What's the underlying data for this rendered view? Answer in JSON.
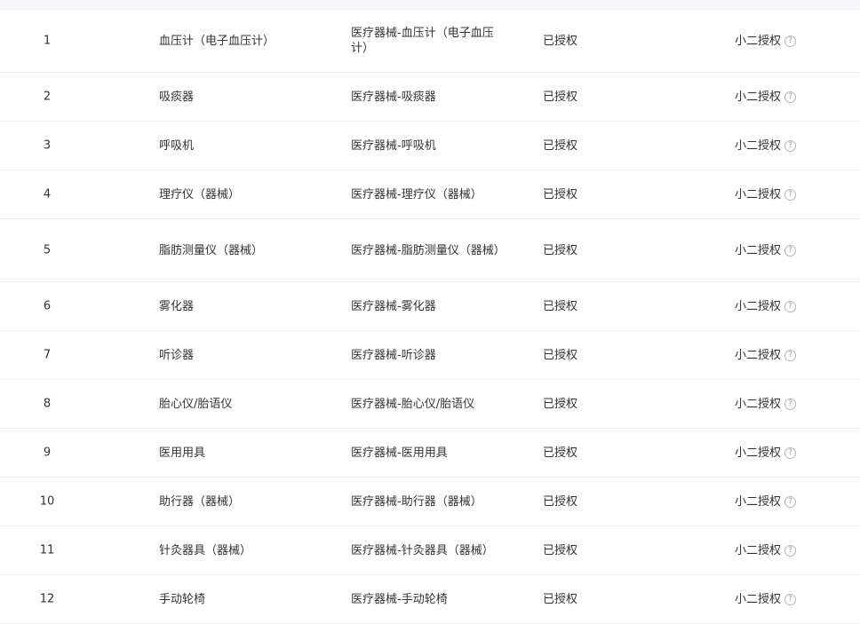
{
  "rows": [
    {
      "index": "1",
      "name": "血压计（电子血压计）",
      "category": "医疗器械-血压计（电子血压计）",
      "status": "已授权",
      "auth": "小二授权",
      "auth_icon": "help-circle-icon"
    },
    {
      "index": "2",
      "name": "吸痰器",
      "category": "医疗器械-吸痰器",
      "status": "已授权",
      "auth": "小二授权",
      "auth_icon": "help-circle-icon"
    },
    {
      "index": "3",
      "name": "呼吸机",
      "category": "医疗器械-呼吸机",
      "status": "已授权",
      "auth": "小二授权",
      "auth_icon": "help-circle-icon"
    },
    {
      "index": "4",
      "name": "理疗仪（器械）",
      "category": "医疗器械-理疗仪（器械）",
      "status": "已授权",
      "auth": "小二授权",
      "auth_icon": "help-circle-icon"
    },
    {
      "index": "5",
      "name": "脂肪测量仪（器械）",
      "category": "医疗器械-脂肪测量仪（器械）",
      "status": "已授权",
      "auth": "小二授权",
      "auth_icon": "help-circle-icon"
    },
    {
      "index": "6",
      "name": "雾化器",
      "category": "医疗器械-雾化器",
      "status": "已授权",
      "auth": "小二授权",
      "auth_icon": "help-circle-icon"
    },
    {
      "index": "7",
      "name": "听诊器",
      "category": "医疗器械-听诊器",
      "status": "已授权",
      "auth": "小二授权",
      "auth_icon": "help-circle-icon"
    },
    {
      "index": "8",
      "name": "胎心仪/胎语仪",
      "category": "医疗器械-胎心仪/胎语仪",
      "status": "已授权",
      "auth": "小二授权",
      "auth_icon": "help-circle-icon"
    },
    {
      "index": "9",
      "name": "医用用具",
      "category": "医疗器械-医用用具",
      "status": "已授权",
      "auth": "小二授权",
      "auth_icon": "help-circle-icon"
    },
    {
      "index": "10",
      "name": "助行器（器械）",
      "category": "医疗器械-助行器（器械）",
      "status": "已授权",
      "auth": "小二授权",
      "auth_icon": "help-circle-icon"
    },
    {
      "index": "11",
      "name": "针灸器具（器械）",
      "category": "医疗器械-针灸器具（器械）",
      "status": "已授权",
      "auth": "小二授权",
      "auth_icon": "help-circle-icon"
    },
    {
      "index": "12",
      "name": "手动轮椅",
      "category": "医疗器械-手动轮椅",
      "status": "已授权",
      "auth": "小二授权",
      "auth_icon": "help-circle-icon"
    }
  ]
}
